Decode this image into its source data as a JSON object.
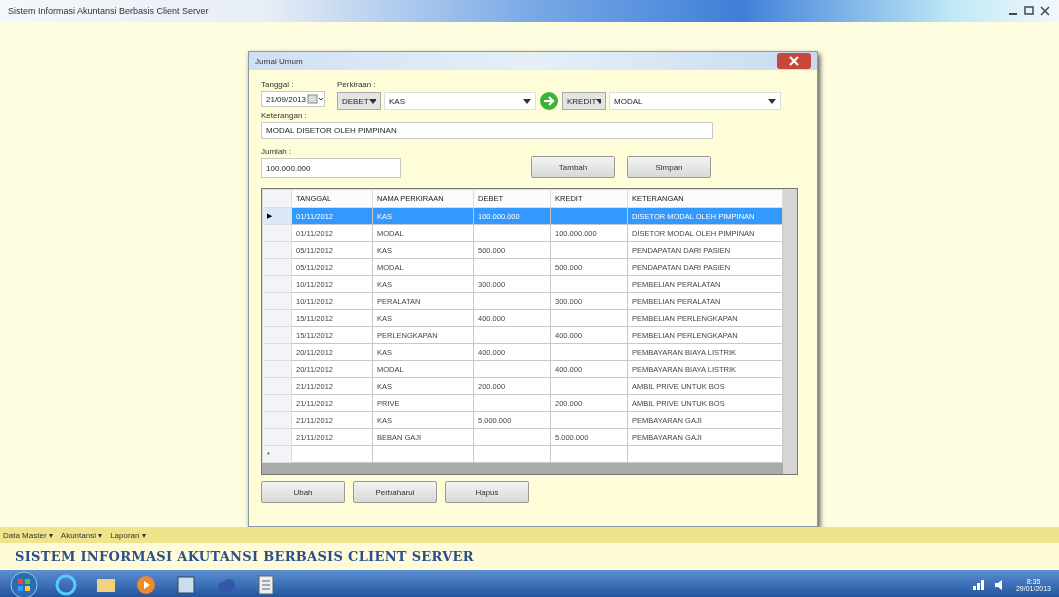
{
  "window": {
    "title": "Sistem Informasi Akuntansi Berbasis Client Server"
  },
  "dialog": {
    "title": "Jurnal Umum",
    "tanggal": {
      "label": "Tanggal :",
      "value": "21/09/2013"
    },
    "perkiraan": {
      "label": "Perkiraan :",
      "debit_type": "DEBET",
      "debit_account": "KAS",
      "credit_type": "KREDIT",
      "credit_account": "MODAL"
    },
    "keterangan": {
      "label": "Keterangan :",
      "value": "MODAL DISETOR OLEH PIMPINAN"
    },
    "jumlah": {
      "label": "Jumlah :",
      "value": "100.000.000"
    },
    "top_buttons": [
      "Tambah",
      "Simpan"
    ],
    "table": {
      "columns": [
        "TANGGAL",
        "NAMA PERKIRAAN",
        "DEBET",
        "KREDIT",
        "KETERANGAN"
      ],
      "current_indicator": "▶",
      "new_row_indicator": "*",
      "rows": [
        {
          "selected": true,
          "cells": [
            "01/11/2012",
            "KAS",
            "100.000.000",
            "",
            "DISETOR MODAL OLEH PIMPINAN"
          ]
        },
        {
          "selected": false,
          "cells": [
            "01/11/2012",
            "MODAL",
            "",
            "100.000.000",
            "DISETOR MODAL OLEH PIMPINAN"
          ]
        },
        {
          "selected": false,
          "cells": [
            "05/11/2012",
            "KAS",
            "500.000",
            "",
            "PENDAPATAN DARI PASIEN"
          ]
        },
        {
          "selected": false,
          "cells": [
            "05/11/2012",
            "MODAL",
            "",
            "500.000",
            "PENDAPATAN DARI PASIEN"
          ]
        },
        {
          "selected": false,
          "cells": [
            "10/11/2012",
            "KAS",
            "300.000",
            "",
            "PEMBELIAN PERALATAN"
          ]
        },
        {
          "selected": false,
          "cells": [
            "10/11/2012",
            "PERALATAN",
            "",
            "300.000",
            "PEMBELIAN PERALATAN"
          ]
        },
        {
          "selected": false,
          "cells": [
            "15/11/2012",
            "KAS",
            "400.000",
            "",
            "PEMBELIAN PERLENGKAPAN"
          ]
        },
        {
          "selected": false,
          "cells": [
            "15/11/2012",
            "PERLENGKAPAN",
            "",
            "400.000",
            "PEMBELIAN PERLENGKAPAN"
          ]
        },
        {
          "selected": false,
          "cells": [
            "20/11/2012",
            "KAS",
            "400.000",
            "",
            "PEMBAYARAN BIAYA LISTRIK"
          ]
        },
        {
          "selected": false,
          "cells": [
            "20/11/2012",
            "MODAL",
            "",
            "400.000",
            "PEMBAYARAN BIAYA LISTRIK"
          ]
        },
        {
          "selected": false,
          "cells": [
            "21/11/2012",
            "KAS",
            "200.000",
            "",
            "AMBIL PRIVE UNTUK BOS"
          ]
        },
        {
          "selected": false,
          "cells": [
            "21/11/2012",
            "PRIVE",
            "",
            "200.000",
            "AMBIL PRIVE UNTUK BOS"
          ]
        },
        {
          "selected": false,
          "cells": [
            "21/11/2012",
            "KAS",
            "5.000.000",
            "",
            "PEMBAYARAN GAJI"
          ]
        },
        {
          "selected": false,
          "cells": [
            "21/11/2012",
            "BEBAN GAJI",
            "",
            "5.000.000",
            "PEMBAYARAN GAJI"
          ]
        }
      ]
    },
    "bottom_buttons": [
      "Ubah",
      "Perbaharui",
      "Hapus"
    ]
  },
  "menu": [
    "Data Master ▾",
    "Akuntansi ▾",
    "Laporan ▾"
  ],
  "banner": "SISTEM INFORMASI AKUTANSI BERBASIS CLIENT SERVER",
  "taskbar": {
    "time": "8:35",
    "date": "29/01/2013"
  }
}
